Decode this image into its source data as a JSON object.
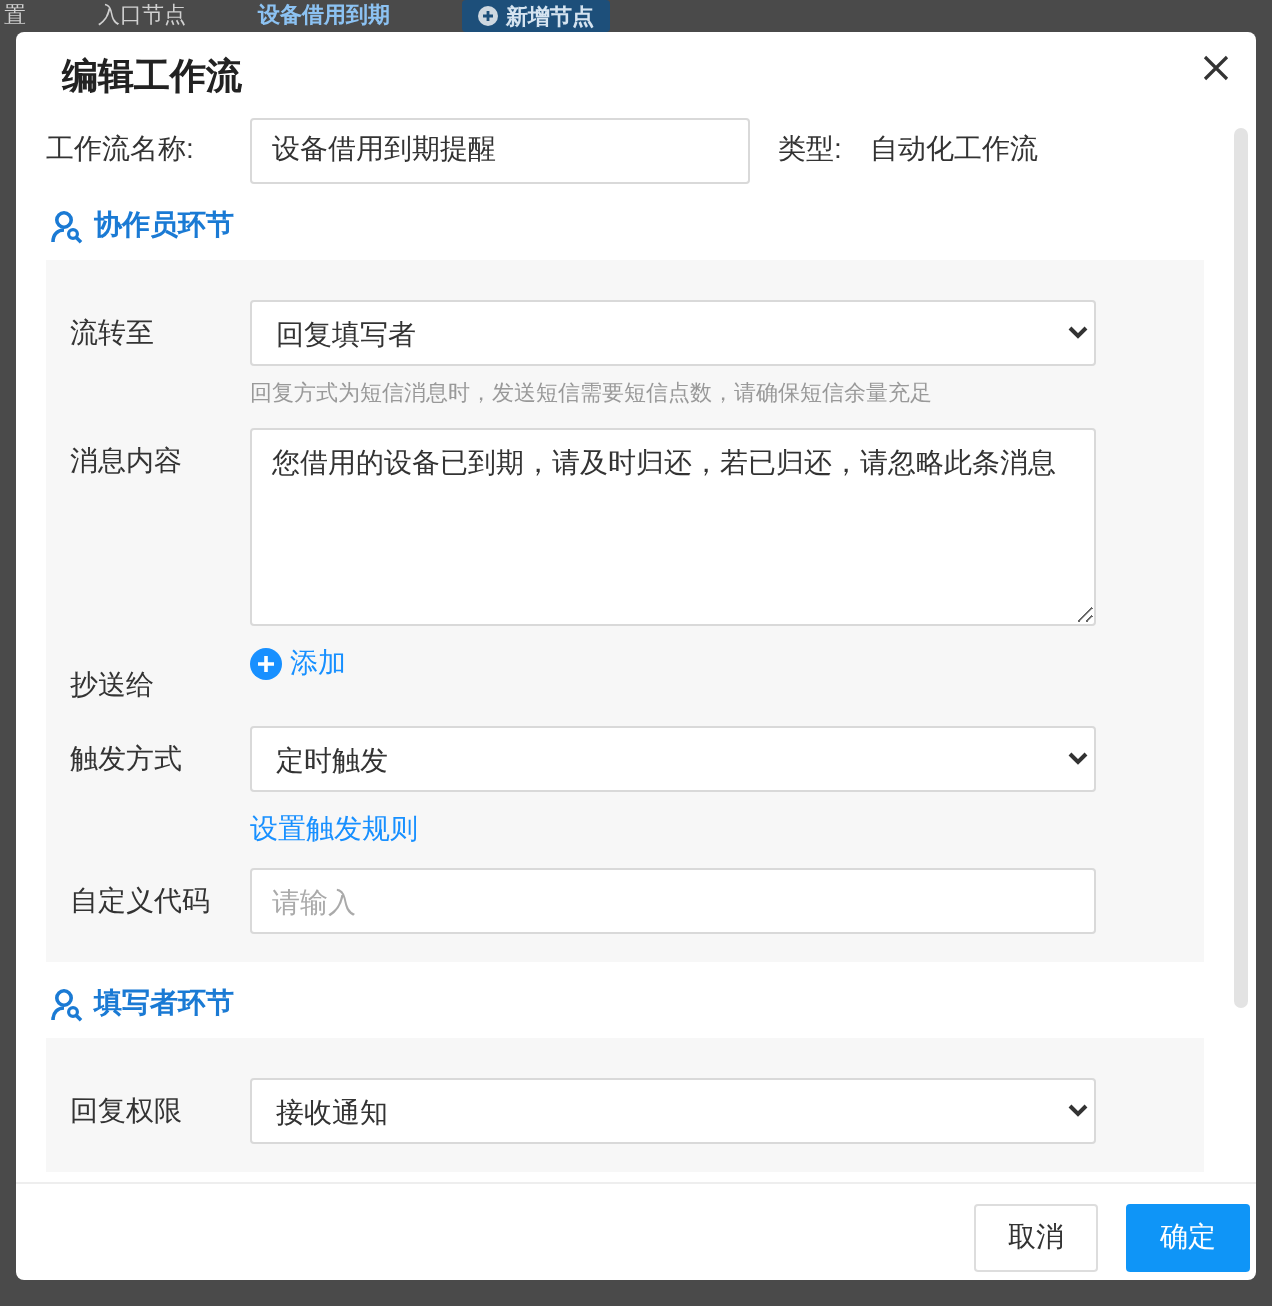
{
  "backdrop": {
    "tabs": [
      {
        "label": "置",
        "selected": false
      },
      {
        "label": "入口节点",
        "selected": false
      },
      {
        "label": "设备借用到期",
        "selected": true
      }
    ],
    "add_button": {
      "label": "新增节点"
    }
  },
  "dialog": {
    "title": "编辑工作流",
    "name_field": {
      "label": "工作流名称:",
      "value": "设备借用到期提醒"
    },
    "type": {
      "label": "类型:",
      "value": "自动化工作流"
    },
    "sections": [
      {
        "title": "协作员环节",
        "fields": [
          {
            "kind": "select",
            "label": "流转至",
            "value": "回复填写者",
            "hint": "回复方式为短信消息时，发送短信需要短信点数，请确保短信余量充足"
          },
          {
            "kind": "textarea",
            "label": "消息内容",
            "value": "您借用的设备已到期，请及时归还，若已归还，请忽略此条消息"
          },
          {
            "kind": "add",
            "label": "抄送给",
            "action": "添加"
          },
          {
            "kind": "select",
            "label": "触发方式",
            "value": "定时触发",
            "link": "设置触发规则"
          },
          {
            "kind": "input",
            "label": "自定义代码",
            "placeholder": "请输入"
          }
        ]
      },
      {
        "title": "填写者环节",
        "fields": [
          {
            "kind": "select",
            "label": "回复权限",
            "value": "接收通知"
          }
        ]
      }
    ],
    "buttons": [
      {
        "label": "取消",
        "kind": "default"
      },
      {
        "label": "确定",
        "kind": "primary"
      }
    ]
  }
}
